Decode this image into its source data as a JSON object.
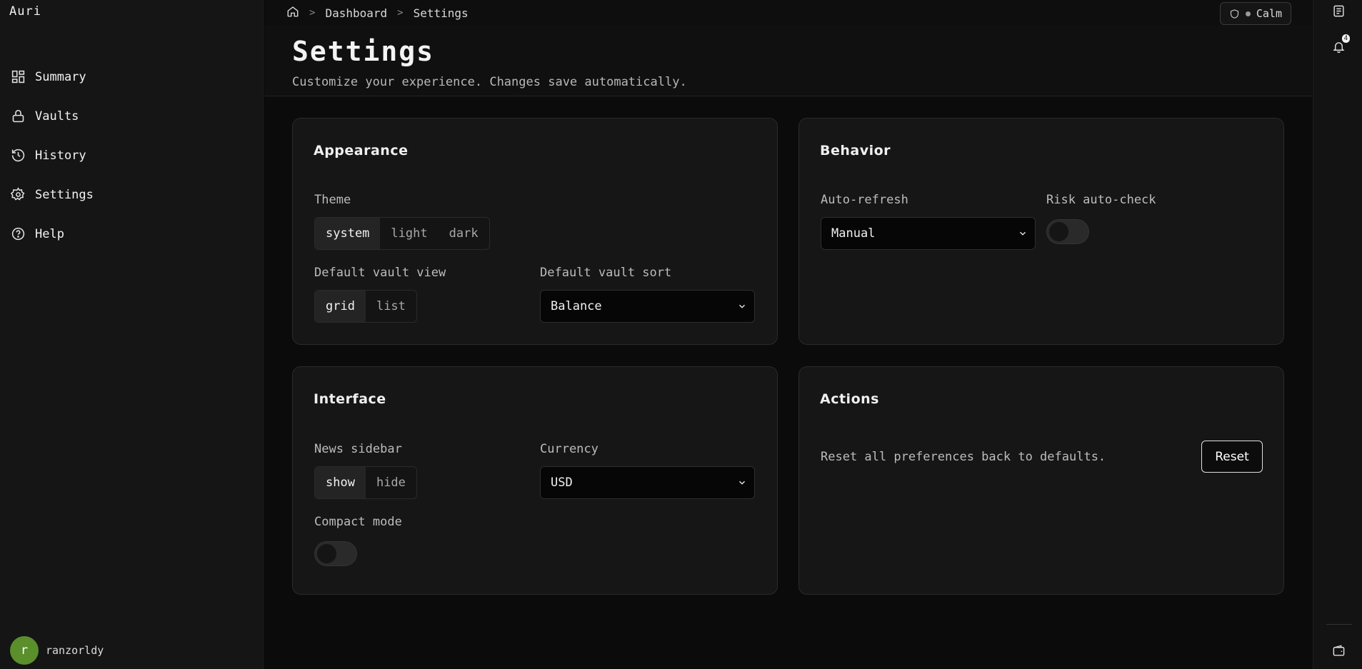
{
  "app": {
    "brand": "Auri"
  },
  "sidebar": {
    "items": [
      {
        "label": "Summary",
        "icon": "dashboard-grid-icon"
      },
      {
        "label": "Vaults",
        "icon": "lock-icon"
      },
      {
        "label": "History",
        "icon": "history-clock-icon"
      },
      {
        "label": "Settings",
        "icon": "gear-icon"
      },
      {
        "label": "Help",
        "icon": "help-circle-icon"
      }
    ],
    "user": {
      "initial": "r",
      "name": "ranzorldy",
      "avatar_color": "#5a8f2c"
    }
  },
  "topbar": {
    "breadcrumb": [
      "Dashboard",
      "Settings"
    ],
    "mode_label": "Calm"
  },
  "rail": {
    "notification_count": "4"
  },
  "page": {
    "title": "Settings",
    "subtitle": "Customize your experience. Changes save automatically."
  },
  "appearance": {
    "title": "Appearance",
    "theme_label": "Theme",
    "theme_options": [
      "system",
      "light",
      "dark"
    ],
    "theme_selected": "system",
    "view_label": "Default vault view",
    "view_options": [
      "grid",
      "list"
    ],
    "view_selected": "grid",
    "sort_label": "Default vault sort",
    "sort_value": "Balance"
  },
  "behavior": {
    "title": "Behavior",
    "refresh_label": "Auto-refresh",
    "refresh_value": "Manual",
    "risk_label": "Risk auto-check",
    "risk_enabled": false
  },
  "interface": {
    "title": "Interface",
    "news_label": "News sidebar",
    "news_options": [
      "show",
      "hide"
    ],
    "news_selected": "show",
    "currency_label": "Currency",
    "currency_value": "USD",
    "compact_label": "Compact mode",
    "compact_enabled": false
  },
  "actions": {
    "title": "Actions",
    "reset_text": "Reset all preferences back to defaults.",
    "reset_button": "Reset"
  }
}
